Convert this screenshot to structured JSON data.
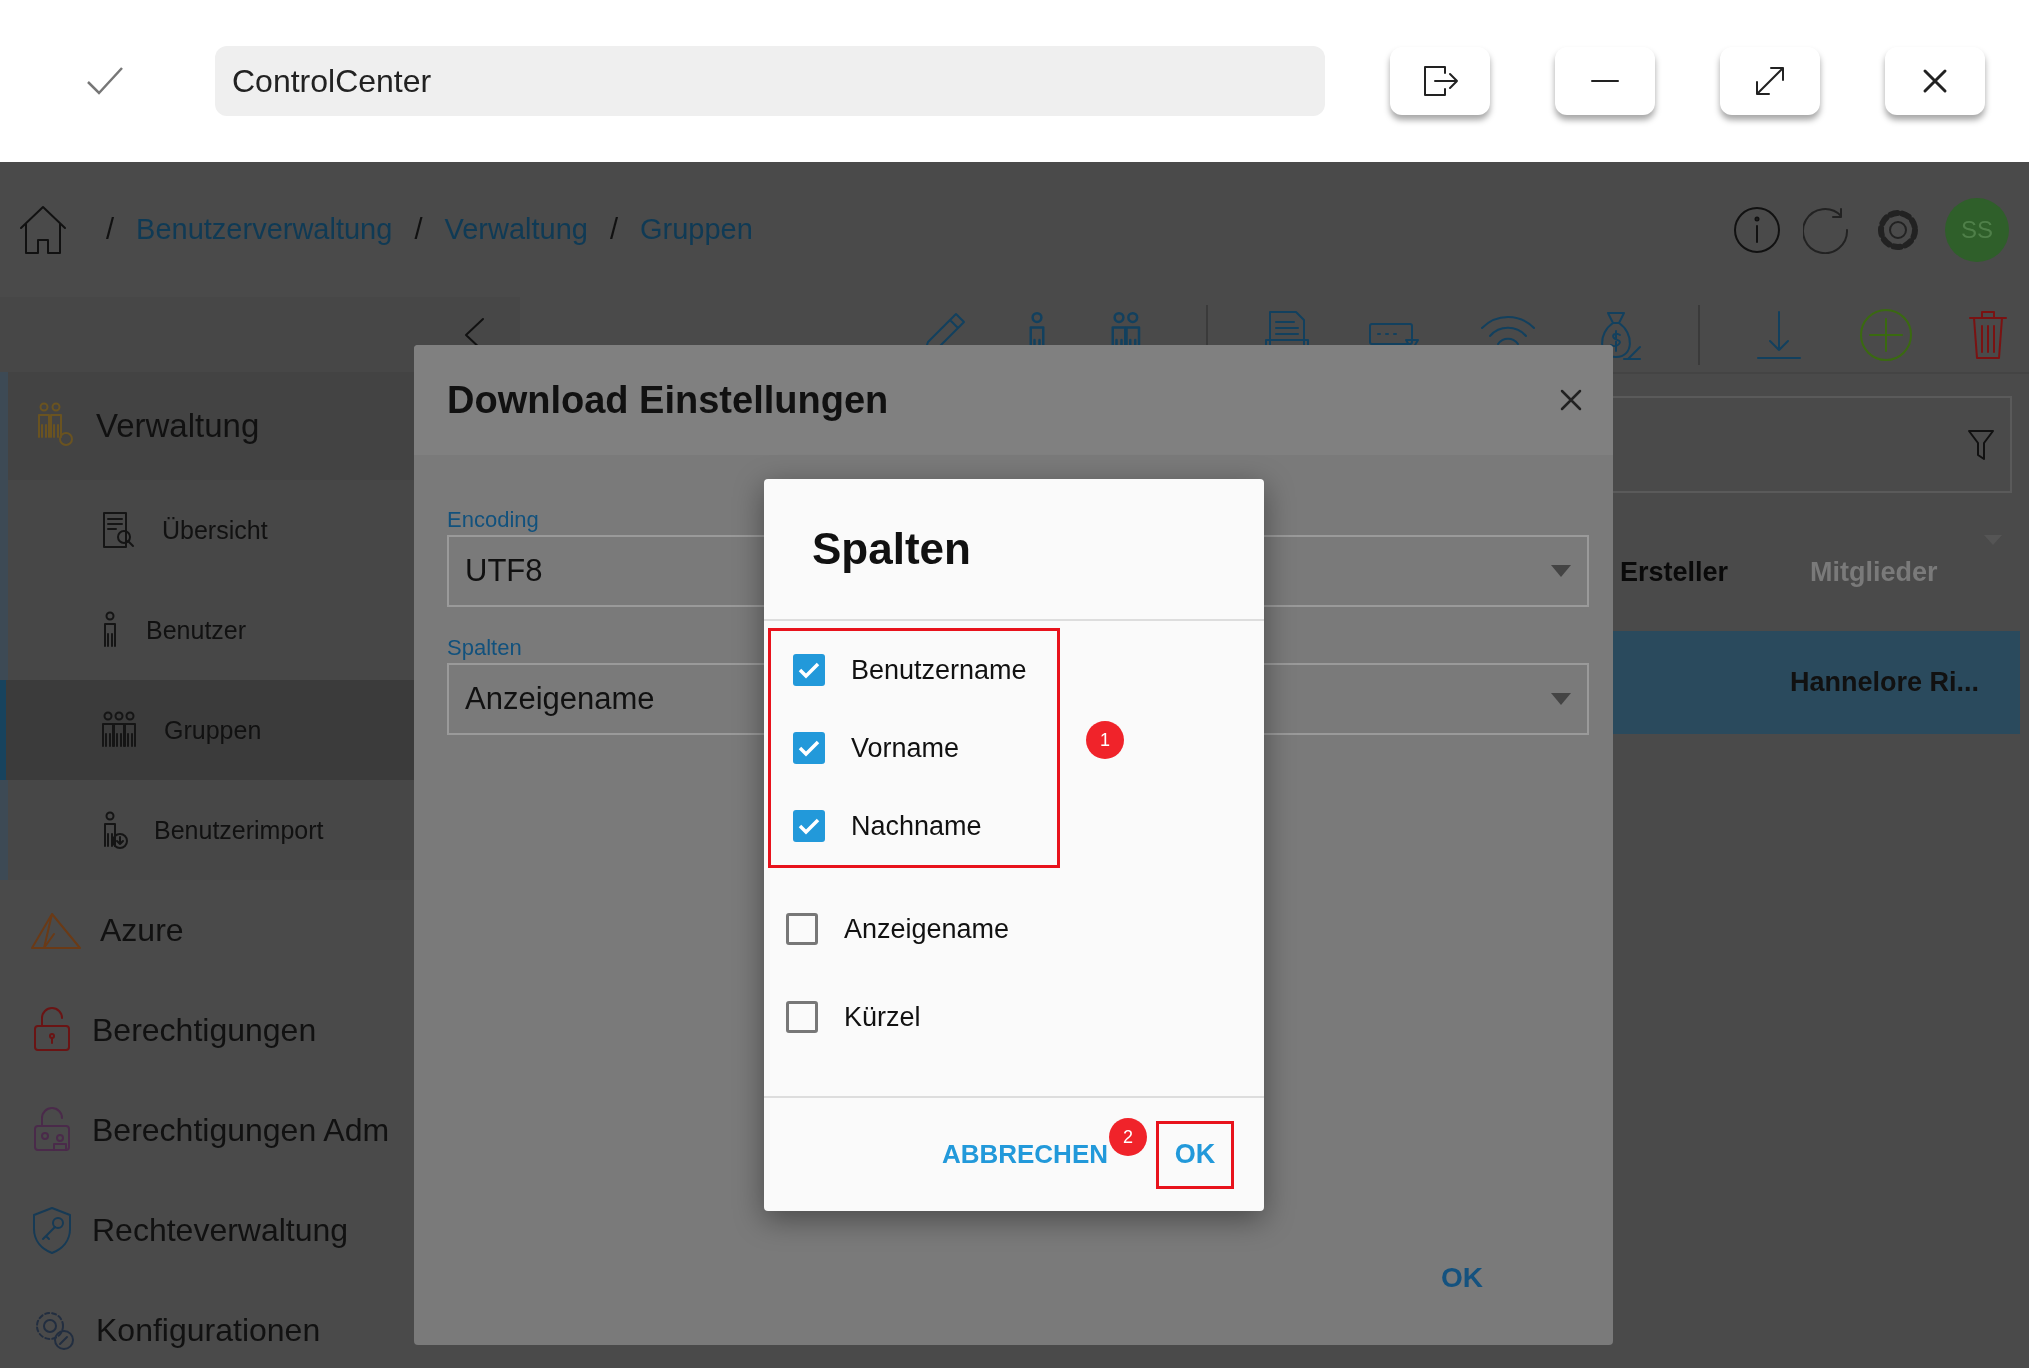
{
  "title_bar": {
    "title": "ControlCenter"
  },
  "breadcrumb": [
    {
      "separator": "/",
      "label": "Benutzerverwaltung"
    },
    {
      "separator": "/",
      "label": "Verwaltung"
    },
    {
      "separator": "/",
      "label": "Gruppen"
    }
  ],
  "user": {
    "initials": "SS"
  },
  "sidebar": {
    "items": [
      {
        "label": "Verwaltung",
        "children": [
          {
            "label": "Übersicht",
            "selected": false
          },
          {
            "label": "Benutzer",
            "selected": false
          },
          {
            "label": "Gruppen",
            "selected": true
          },
          {
            "label": "Benutzerimport",
            "selected": false
          }
        ]
      },
      {
        "label": "Azure"
      },
      {
        "label": "Berechtigungen"
      },
      {
        "label": "Berechtigungen Adm"
      },
      {
        "label": "Rechteverwaltung"
      },
      {
        "label": "Konfigurationen"
      }
    ]
  },
  "table": {
    "columns": [
      {
        "label": "Ersteller",
        "active": true
      },
      {
        "label": "Mitglieder",
        "active": false
      }
    ],
    "rows": [
      {
        "cells": [
          "",
          "Hannelore Ri..."
        ],
        "selected": true
      }
    ]
  },
  "download_dialog": {
    "title": "Download Einstellungen",
    "fields": [
      {
        "label": "Encoding",
        "value": "UTF8"
      },
      {
        "label": "Spalten",
        "value": "Anzeigename"
      }
    ],
    "ok": "OK"
  },
  "columns_dialog": {
    "title": "Spalten",
    "badge": "1",
    "items": [
      {
        "label": "Benutzername",
        "checked": true,
        "highlighted": true
      },
      {
        "label": "Vorname",
        "checked": true,
        "highlighted": true
      },
      {
        "label": "Nachname",
        "checked": true,
        "highlighted": true
      },
      {
        "label": "Anzeigename",
        "checked": false,
        "highlighted": false
      },
      {
        "label": "Kürzel",
        "checked": false,
        "highlighted": false
      }
    ],
    "cancel": "ABBRECHEN",
    "ok": {
      "label": "OK",
      "highlighted": true
    },
    "footer_badge": "2"
  }
}
